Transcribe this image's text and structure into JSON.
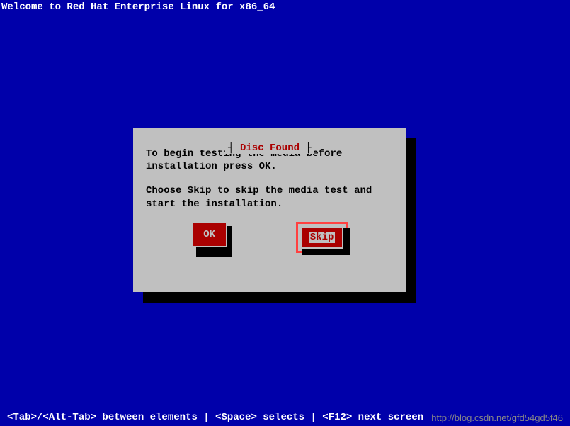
{
  "header": {
    "title": "Welcome to Red Hat Enterprise Linux for x86_64"
  },
  "dialog": {
    "title": "Disc Found",
    "text1": "To begin testing the media before installation press OK.",
    "text2": "Choose Skip to skip the media test and start the installation.",
    "buttons": {
      "ok": "OK",
      "skip": "Skip"
    }
  },
  "footer": {
    "help": "<Tab>/<Alt-Tab> between elements  | <Space> selects | <F12> next screen",
    "watermark": "http://blog.csdn.net/gfd54gd5f46"
  }
}
